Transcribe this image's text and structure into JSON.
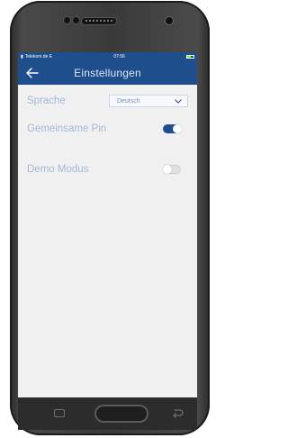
{
  "status_bar": {
    "carrier": "Telekom.de E",
    "time": "07:56"
  },
  "app_bar": {
    "title": "Einstellungen",
    "back_icon": "arrow-left-icon"
  },
  "settings": {
    "language": {
      "label": "Sprache",
      "selected": "Deutsch"
    },
    "shared_pin": {
      "label": "Gemeinsame Pin",
      "on": true
    },
    "demo_mode": {
      "label": "Demo Modus",
      "on": false
    }
  },
  "colors": {
    "primary": "#1f4e8c",
    "label_text": "#a3b9d8",
    "background": "#f0f0f0"
  }
}
